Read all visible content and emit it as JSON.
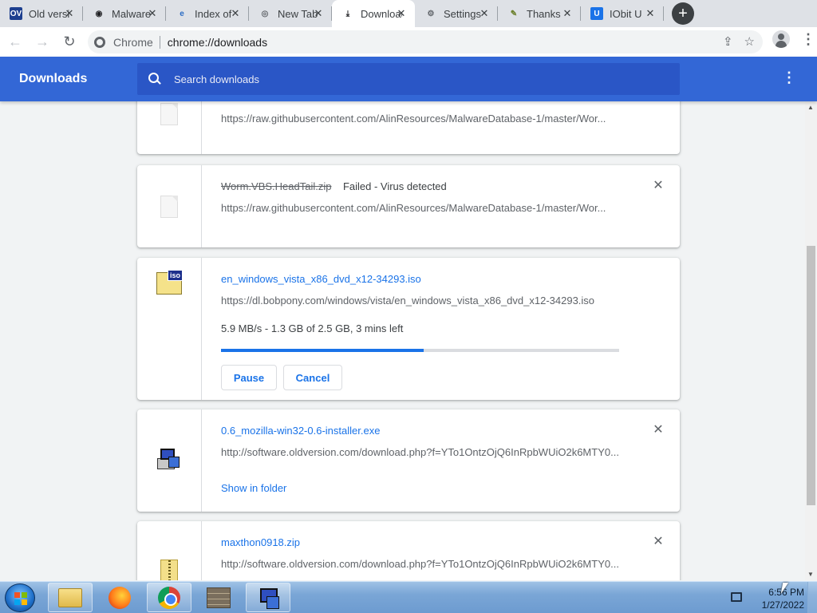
{
  "tabs": [
    {
      "title": "Old versi",
      "favicon_text": "OV",
      "favicon_bg": "#1d3f8f",
      "favicon_color": "#ffffff",
      "icon": "oldversion-icon"
    },
    {
      "title": "Malware",
      "favicon_text": "◉",
      "favicon_bg": "transparent",
      "favicon_color": "#202124",
      "icon": "github-icon"
    },
    {
      "title": "Index of",
      "favicon_text": "e",
      "favicon_bg": "transparent",
      "favicon_color": "#2b6cc4",
      "icon": "ie-page-icon"
    },
    {
      "title": "New Tab",
      "favicon_text": "◎",
      "favicon_bg": "transparent",
      "favicon_color": "#5f6368",
      "icon": "chrome-icon"
    },
    {
      "title": "Downloads",
      "favicon_text": "⤓",
      "favicon_bg": "transparent",
      "favicon_color": "#202124",
      "icon": "download-icon",
      "active": true
    },
    {
      "title": "Settings",
      "favicon_text": "⚙",
      "favicon_bg": "transparent",
      "favicon_color": "#5f6368",
      "icon": "gear-icon"
    },
    {
      "title": "Thanks",
      "favicon_text": "✎",
      "favicon_bg": "transparent",
      "favicon_color": "#6b7f2a",
      "icon": "pen-icon"
    },
    {
      "title": "IObit U",
      "favicon_text": "U",
      "favicon_bg": "#1a73e8",
      "favicon_color": "#ffffff",
      "icon": "iobit-icon"
    }
  ],
  "toolbar": {
    "site_label": "Chrome",
    "url": "chrome://downloads"
  },
  "header": {
    "title": "Downloads",
    "search_placeholder": "Search downloads"
  },
  "downloads": [
    {
      "filename": "",
      "status": "",
      "url": "https://raw.githubusercontent.com/AlinResources/MalwareDatabase-1/master/Wor..."
    },
    {
      "filename": "Worm.VBS.HeadTail.zip",
      "status": "Failed - Virus detected",
      "url": "https://raw.githubusercontent.com/AlinResources/MalwareDatabase-1/master/Wor..."
    },
    {
      "filename": "en_windows_vista_x86_dvd_x12-34293.iso",
      "url": "https://dl.bobpony.com/windows/vista/en_windows_vista_x86_dvd_x12-34293.iso",
      "progress_text": "5.9 MB/s - 1.3 GB of 2.5 GB, 3 mins left",
      "progress_fraction": 0.51,
      "pause_label": "Pause",
      "cancel_label": "Cancel"
    },
    {
      "filename": "0.6_mozilla-win32-0.6-installer.exe",
      "url": "http://software.oldversion.com/download.php?f=YTo1OntzOjQ6InRpbWUiO2k6MTY0...",
      "link_label": "Show in folder"
    },
    {
      "filename": "maxthon0918.zip",
      "url": "http://software.oldversion.com/download.php?f=YTo1OntzOjQ6InRpbWUiO2k6MTY0..."
    }
  ],
  "taskbar": {
    "time": "6:56 PM",
    "date": "1/27/2022"
  }
}
